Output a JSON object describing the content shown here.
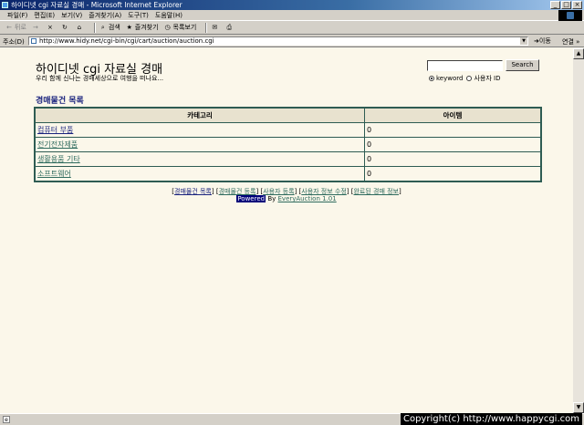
{
  "window": {
    "title": "하이디넷 cgi 자료실 경매 - Microsoft Internet Explorer",
    "buttons": [
      "_",
      "□",
      "×"
    ]
  },
  "menu": [
    "파일(F)",
    "편집(E)",
    "보기(V)",
    "즐겨찾기(A)",
    "도구(T)",
    "도움말(H)"
  ],
  "toolbar": {
    "back": "뒤로",
    "forward": "→",
    "stop": "×",
    "refresh": "↻",
    "home": "⌂",
    "search": "검색",
    "favorites": "즐겨찾기",
    "history": "목록보기",
    "mail": "✉",
    "print": "⎙"
  },
  "address": {
    "label": "주소(D)",
    "url": "http://www.hidy.net/cgi-bin/cgi/cart/auction/auction.cgi",
    "go": "이동",
    "links": "연결 »"
  },
  "page": {
    "title": "하이디넷 cgi 자료실 경매",
    "subtitle": "우리 함께 신나는 경매세상으로 여행을 떠나요...",
    "search_button": "Search",
    "radio_keyword": "keyword",
    "radio_user": "사용자 ID",
    "section_title": "경매물건 목록",
    "table": {
      "headers": [
        "카테고리",
        "아이템"
      ],
      "rows": [
        {
          "category": "컴퓨터 부품",
          "items": "0"
        },
        {
          "category": "전기전자제품",
          "items": "0"
        },
        {
          "category": "생활용품 기타",
          "items": "0"
        },
        {
          "category": "소프트웨어",
          "items": "0"
        }
      ]
    },
    "footer_links": [
      "경매물건 목록",
      "경매물건 등록",
      "사용자 등록",
      "사용자 정보 수정",
      "완료된 경매 정보"
    ],
    "powered_hl": "Powered",
    "powered_by": "By",
    "powered_link": "EveryAuction 1.01"
  },
  "status": {
    "icon": "e"
  },
  "watermark": "Copyright(c) http://www.happycgi.com"
}
